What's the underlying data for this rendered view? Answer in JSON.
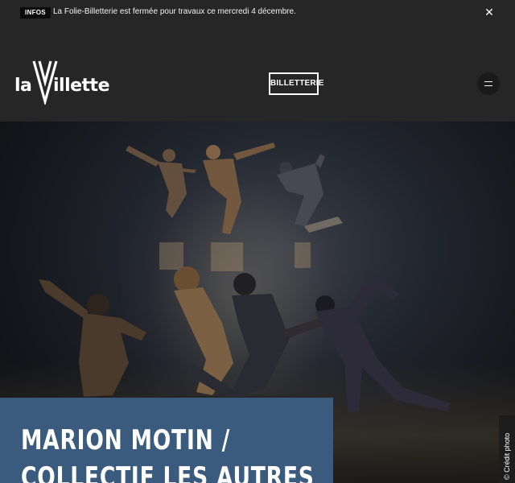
{
  "banner": {
    "tag": "INFOS",
    "message": "La Folie-Billetterie est fermée pour travaux ce mercredi 4 décembre.",
    "close_icon": "close-icon"
  },
  "header": {
    "logo": {
      "left": "la",
      "right": "illette",
      "icon": "v-logo-icon"
    },
    "billetterie_label": "BILLETTERIE",
    "menu_icon": "hamburger-menu-icon"
  },
  "hero": {
    "title_line1": "MARION MOTIN /",
    "title_line2": "COLLECTIF LES AUTRES",
    "photo_credit": "© Crédit photo",
    "title_bg": "#3b5b7e"
  },
  "colors": {
    "page_bg": "#262626",
    "tag_bg": "#0b0b0b",
    "text": "#ffffff"
  }
}
